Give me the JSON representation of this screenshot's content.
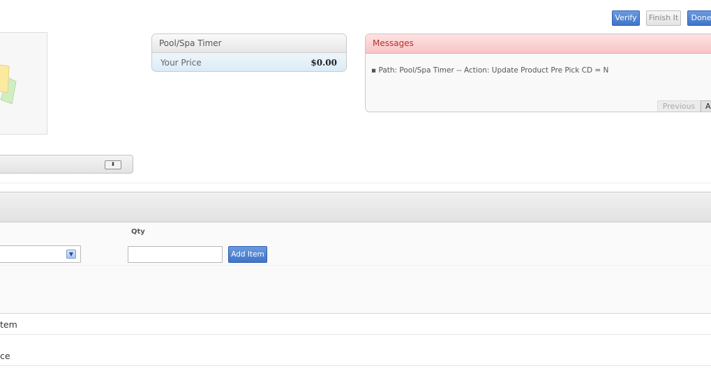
{
  "toolbar": {
    "verify_label": "Verify",
    "finish_label": "Finish It",
    "done_label": "Done"
  },
  "price_panel": {
    "title": "Pool/Spa Timer",
    "price_label": "Your Price",
    "price_value": "$0.00"
  },
  "messages_panel": {
    "title": "Messages",
    "items": [
      "Path: Pool/Spa Timer -- Action: Update Product Pre Pick CD = N"
    ],
    "prev_label": "Previous",
    "all_label": "All"
  },
  "add_item_form": {
    "qty_label": "Qty",
    "qty_value": "",
    "add_button_label": "Add Item"
  },
  "rows": {
    "item_label": "tem",
    "price_label": "ce"
  },
  "colors": {
    "primary_button": "#4a7fd4",
    "messages_header": "#f7c5c5",
    "messages_title": "#b3312f",
    "price_row": "#d9ebf6"
  }
}
